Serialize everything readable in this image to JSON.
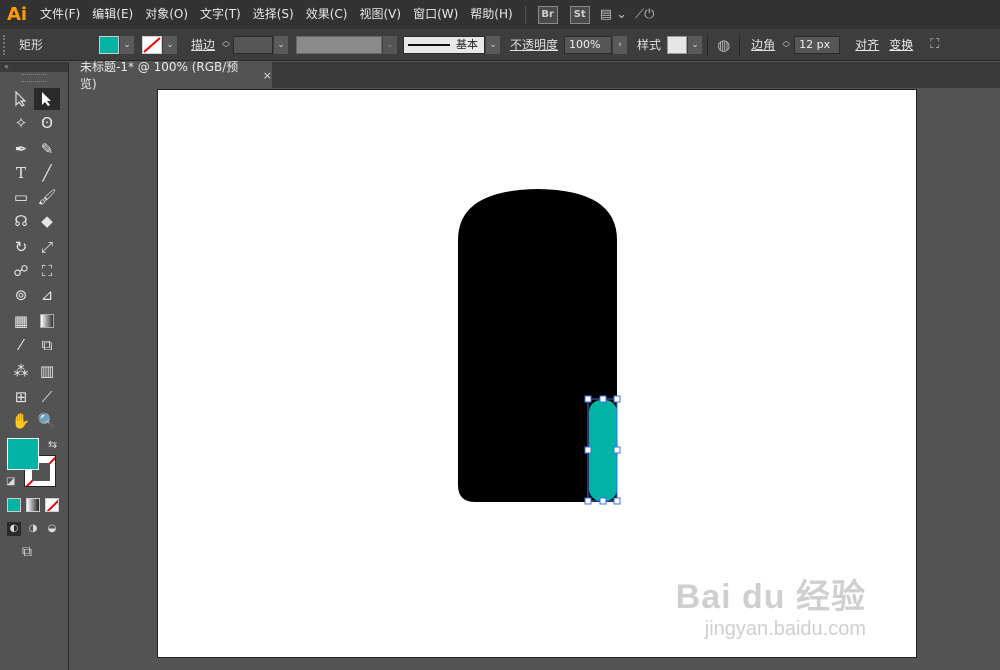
{
  "app": {
    "logo": "Ai"
  },
  "menu": [
    "文件(F)",
    "编辑(E)",
    "对象(O)",
    "文字(T)",
    "选择(S)",
    "效果(C)",
    "视图(V)",
    "窗口(W)",
    "帮助(H)"
  ],
  "menu_badges": {
    "bridge": "Br",
    "stock": "St"
  },
  "control": {
    "shape_label": "矩形",
    "fill_color": "#00b3a4",
    "stroke_label": "描边",
    "stroke_width": "",
    "brush_label": "基本",
    "opacity_label": "不透明度",
    "opacity_value": "100%",
    "style_label": "样式",
    "corner_label": "边角",
    "corner_value": "12 px",
    "align_label": "对齐",
    "transform_label": "变换"
  },
  "tools_panel": {
    "collapse": "«"
  },
  "document": {
    "tab_title": "未标题-1* @ 100% (RGB/预览)",
    "close": "×"
  },
  "canvas": {
    "shape_fill": "#000000",
    "selected_fill": "#00b3a4",
    "selection_color": "#3b6ff0"
  },
  "watermark": {
    "brand": "Bai du 经验",
    "url": "jingyan.baidu.com"
  }
}
